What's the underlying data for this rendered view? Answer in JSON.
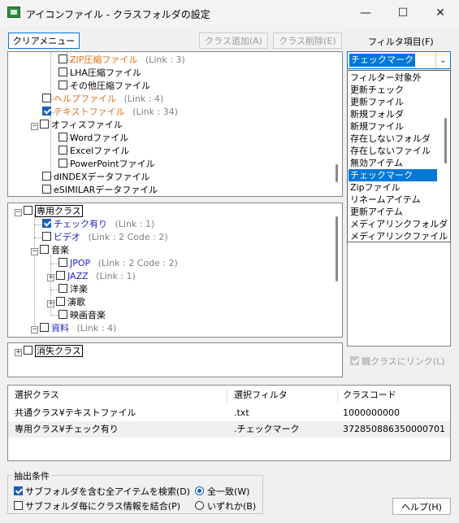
{
  "window": {
    "title": "アイコンファイル - クラスフォルダの設定",
    "minimize": "—",
    "maximize": "☐",
    "close": "✕"
  },
  "toolbar": {
    "clear_menu": "クリアメニュー",
    "add_class": "クラス追加(A)",
    "delete_class": "クラス削除(E)"
  },
  "filter": {
    "label": "フィルタ項目(F)",
    "selected": "チェックマーク",
    "options": [
      "フィルター対象外",
      "更新チェック",
      "更新ファイル",
      "新規フォルダ",
      "新規ファイル",
      "存在しないフォルダ",
      "存在しないファイル",
      "無効アイテム",
      "チェックマーク",
      "Zipファイル",
      "リネームアイテム",
      "更新アイテム",
      "メディアリンクフォルダ",
      "メディアリンクファイル"
    ],
    "parent_link": "親クラスにリンク(L)"
  },
  "tree1": [
    {
      "label": "ZIP圧縮ファイル",
      "info": "(Link : 3)"
    },
    {
      "label": "LHA圧縮ファイル",
      "info": ""
    },
    {
      "label": "その他圧縮ファイル",
      "info": ""
    },
    {
      "label": "ヘルプファイル",
      "info": "(Link : 4)"
    },
    {
      "label": "テキストファイル",
      "info": "(Link : 34)"
    },
    {
      "label": "オフィスファイル",
      "info": ""
    },
    {
      "label": "Wordファイル",
      "info": ""
    },
    {
      "label": "Excelファイル",
      "info": ""
    },
    {
      "label": "PowerPointファイル",
      "info": ""
    },
    {
      "label": "dINDEXデータファイル",
      "info": ""
    },
    {
      "label": "eSIMILARデータファイル",
      "info": ""
    }
  ],
  "tree2": [
    {
      "label": "専用クラス",
      "info": ""
    },
    {
      "label": "チェック有り",
      "info": "(Link : 1)"
    },
    {
      "label": "ビデオ",
      "info": "(Link : 2 Code : 2)"
    },
    {
      "label": "音楽",
      "info": ""
    },
    {
      "label": "JPOP",
      "info": "(Link : 2 Code : 2)"
    },
    {
      "label": "JAZZ",
      "info": "(Link : 1)"
    },
    {
      "label": "洋楽",
      "info": ""
    },
    {
      "label": "演歌",
      "info": ""
    },
    {
      "label": "映画音楽",
      "info": ""
    },
    {
      "label": "資料",
      "info": "(Link : 4)"
    }
  ],
  "tree3": [
    {
      "label": "消失クラス",
      "info": ""
    }
  ],
  "table": {
    "headers": [
      "選択クラス",
      "選択フィルタ",
      "クラスコード"
    ],
    "rows": [
      [
        "共通クラス¥テキストファイル",
        ".txt",
        "1000000000"
      ],
      [
        "専用クラス¥チェック有り",
        ".チェックマーク",
        "372850886350000701"
      ]
    ]
  },
  "extract": {
    "title": "抽出条件",
    "search_all": "サブフォルダを含む全アイテムを検索(D)",
    "merge_class": "サブフォルダ毎にクラス情報を結合(P)",
    "match_all": "全一致(W)",
    "match_any": "いずれか(B)"
  },
  "help_button": "ヘルプ(H)"
}
